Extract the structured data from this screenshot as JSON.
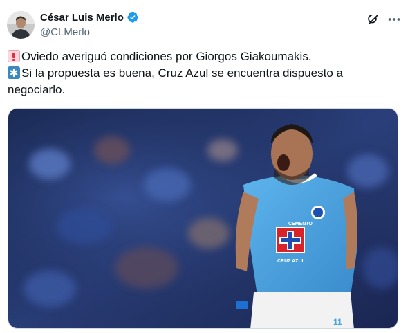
{
  "author": {
    "display_name": "César Luis Merlo",
    "handle": "@CLMerlo",
    "verified": true
  },
  "icons": {
    "verified": "verified-badge-icon",
    "grok": "grok-icon",
    "more": "more-options-icon",
    "line1_emoji": "police-light-emoji",
    "line2_emoji": "asterisk-emoji"
  },
  "tweet": {
    "line1": "Oviedo averiguó condiciones por Giorgos Giakoumakis.",
    "line2": "Si la propuesta es buena, Cruz Azul se encuentra dispuesto a",
    "line3": "negociarlo."
  },
  "media": {
    "jersey_sponsor": "CEMENTO",
    "jersey_club": "CRUZ AZUL",
    "shirt_number": "11"
  },
  "colors": {
    "verified": "#1d9bf0",
    "text": "#0f1419",
    "secondary": "#536471",
    "jersey": "#4aa3df"
  }
}
